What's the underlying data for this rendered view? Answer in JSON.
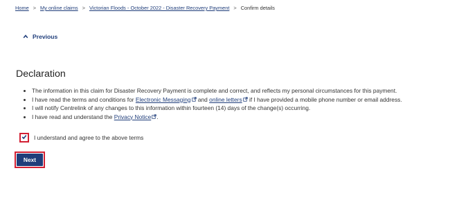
{
  "breadcrumb": {
    "home": "Home",
    "claims": "My online claims",
    "payment": "Victorian Floods - October 2022 - Disaster Recovery Payment",
    "current": "Confirm details",
    "separator": ">"
  },
  "nav": {
    "previous_label": "Previous",
    "previous_icon": "chevron-up-icon"
  },
  "declaration": {
    "title": "Declaration",
    "items": {
      "item1": "The information in this claim for Disaster Recovery Payment is complete and correct, and reflects my personal circumstances for this payment.",
      "item2_pre": "I have read the terms and conditions for ",
      "item2_link1": "Electronic Messaging",
      "item2_mid": " and ",
      "item2_link2": "online letters",
      "item2_post": " if I have provided a mobile phone number or email address.",
      "item3": "I will notify Centrelink of any changes to this information within fourteen (14) days of the change(s) occurring.",
      "item4_pre": "I have read and understand the ",
      "item4_link": "Privacy Notice",
      "item4_post": "."
    },
    "external_link_icon": "external-link-icon"
  },
  "agreement": {
    "label": "I understand and agree to the above terms",
    "checked": true
  },
  "actions": {
    "next_label": "Next"
  },
  "colors": {
    "link": "#1f3d7a",
    "button": "#1f3d7a",
    "highlight": "#d21f33",
    "text": "#333333"
  }
}
